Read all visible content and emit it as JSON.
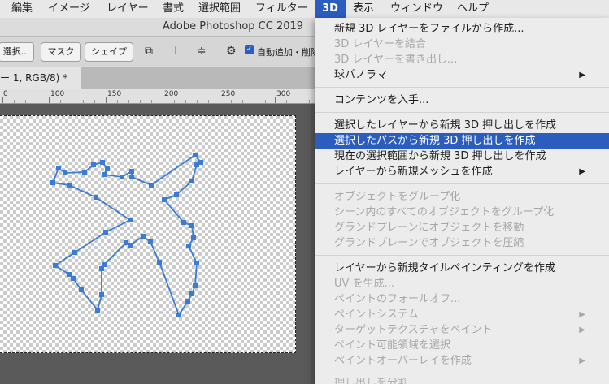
{
  "menubar": {
    "items": [
      "編集",
      "イメージ",
      "レイヤー",
      "書式",
      "選択範囲",
      "フィルター",
      "3D",
      "表示",
      "ウィンドウ",
      "ヘルプ"
    ],
    "active": "3D"
  },
  "window": {
    "title": "Adobe Photoshop CC 2019"
  },
  "options": {
    "select_btn": "選択...",
    "mask_btn": "マスク",
    "shape_btn": "シェイプ",
    "autoadd_label": "自動追加・削除"
  },
  "document": {
    "tab_label": "ー 1, RGB/8) *"
  },
  "ruler": {
    "labels": [
      "0",
      "100",
      "150",
      "200",
      "250",
      "300"
    ]
  },
  "menu3d": {
    "items": [
      {
        "label": "新規 3D レイヤーをファイルから作成...",
        "enabled": true
      },
      {
        "label": "3D レイヤーを結合",
        "enabled": false
      },
      {
        "label": "3D レイヤーを書き出し...",
        "enabled": false
      },
      {
        "label": "球パノラマ",
        "enabled": true,
        "submenu": true
      },
      {
        "label": "コンテンツを入手...",
        "enabled": true
      },
      {
        "label": "選択したレイヤーから新規 3D 押し出しを作成",
        "enabled": true
      },
      {
        "label": "選択したパスから新規 3D 押し出しを作成",
        "enabled": true,
        "highlighted": true
      },
      {
        "label": "現在の選択範囲から新規 3D 押し出しを作成",
        "enabled": true
      },
      {
        "label": "レイヤーから新規メッシュを作成",
        "enabled": true,
        "submenu": true
      },
      {
        "label": "オブジェクトをグループ化",
        "enabled": false
      },
      {
        "label": "シーン内のすべてのオブジェクトをグループ化",
        "enabled": false
      },
      {
        "label": "グランドプレーンにオブジェクトを移動",
        "enabled": false
      },
      {
        "label": "グランドプレーンでオブジェクトを圧縮",
        "enabled": false
      },
      {
        "label": "レイヤーから新規タイルペインティングを作成",
        "enabled": true
      },
      {
        "label": "UV を生成...",
        "enabled": false
      },
      {
        "label": "ペイントのフォールオフ...",
        "enabled": false
      },
      {
        "label": "ペイントシステム",
        "enabled": false,
        "submenu": true
      },
      {
        "label": "ターゲットテクスチャをペイント",
        "enabled": false,
        "submenu": true
      },
      {
        "label": "ペイント可能領域を選択",
        "enabled": false
      },
      {
        "label": "ペイントオーバーレイを作成",
        "enabled": false,
        "submenu": true
      },
      {
        "label": "押し出しを分割",
        "enabled": false
      }
    ]
  },
  "colors": {
    "accent": "#2a5dbe",
    "path": "#3a7bd5"
  }
}
